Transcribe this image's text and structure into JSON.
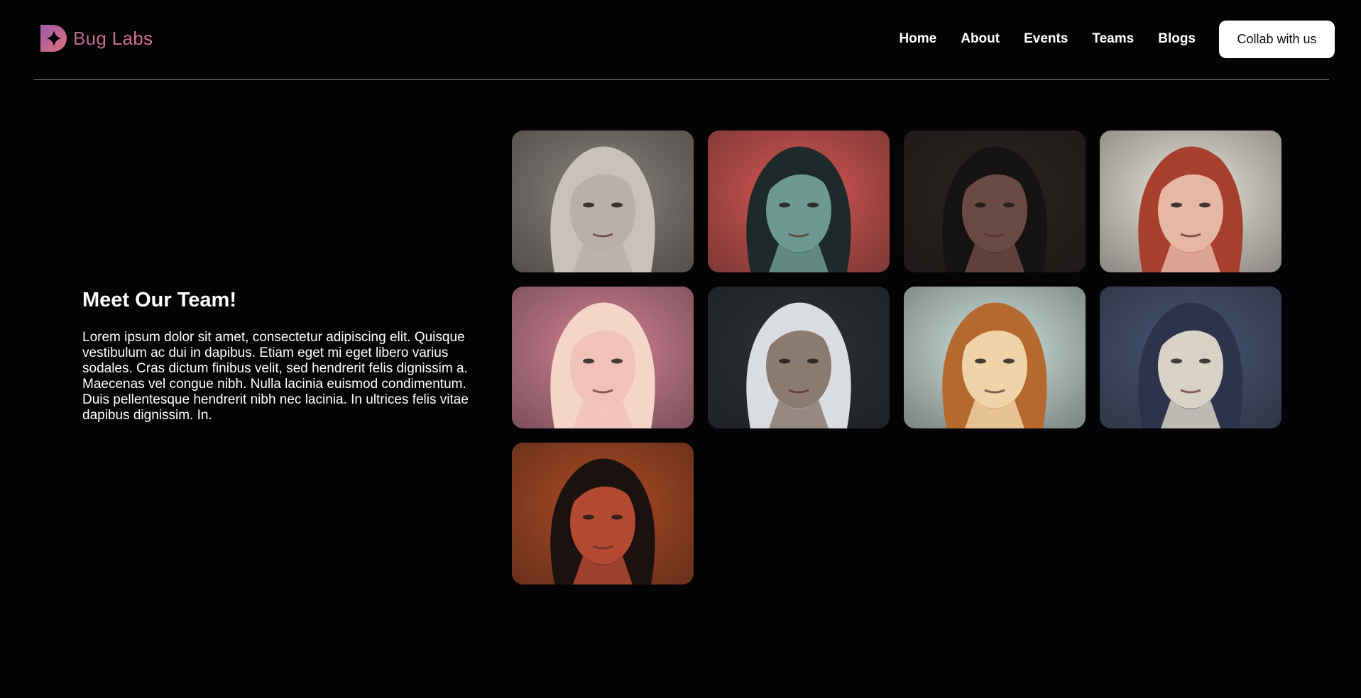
{
  "brand": {
    "name": "Bug Labs",
    "logo_icon": "bug-labs-logo-icon"
  },
  "nav": {
    "items": [
      {
        "label": "Home"
      },
      {
        "label": "About"
      },
      {
        "label": "Events"
      },
      {
        "label": "Teams"
      },
      {
        "label": "Blogs"
      }
    ],
    "cta_label": "Collab with us"
  },
  "intro": {
    "title": "Meet Our Team!",
    "body": "Lorem ipsum dolor sit amet, consectetur adipiscing elit. Quisque vestibulum ac dui in dapibus. Etiam eget mi eget libero varius sodales. Cras dictum finibus velit, sed hendrerit felis dignissim a. Maecenas vel congue nibh. Nulla lacinia euismod condimentum. Duis pellentesque hendrerit nibh nec lacinia. In ultrices felis vitae dapibus dignissim. In."
  },
  "team": [
    {
      "portrait": "grayscale-woman-portrait",
      "bg": "#8c857e",
      "hair": "#c8c2bb",
      "skin": "#b9b1a8"
    },
    {
      "portrait": "green-man-red-background-portrait",
      "bg": "#dc5a55",
      "hair": "#1e2a29",
      "skin": "#6d9a90"
    },
    {
      "portrait": "dark-haired-boy-portrait",
      "bg": "#2a2220",
      "hair": "#151213",
      "skin": "#6b4a44"
    },
    {
      "portrait": "red-haired-girl-flower-portrait",
      "bg": "#f3efe4",
      "hair": "#a8402e",
      "skin": "#e6b7a2"
    },
    {
      "portrait": "pink-haired-bunny-girl-portrait",
      "bg": "#d9869a",
      "hair": "#f5d5c8",
      "skin": "#f0c2b8"
    },
    {
      "portrait": "white-haired-man-portrait",
      "bg": "#2b3236",
      "hair": "#d9dde2",
      "skin": "#8a7a70"
    },
    {
      "portrait": "ginger-boy-profile-portrait",
      "bg": "#d7e9e6",
      "hair": "#b5692f",
      "skin": "#efd2a5"
    },
    {
      "portrait": "underwater-dancer-portrait",
      "bg": "#4a5676",
      "hair": "#2c334a",
      "skin": "#d8d2c6"
    },
    {
      "portrait": "horned-demon-portrait",
      "bg": "#b24c24",
      "hair": "#1b1210",
      "skin": "#b54a32"
    }
  ]
}
